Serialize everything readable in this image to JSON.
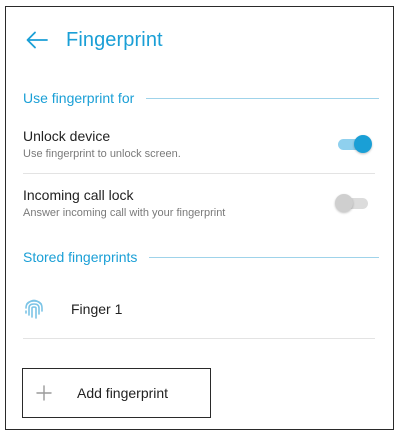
{
  "header": {
    "title": "Fingerprint",
    "back_icon": "arrow-left-icon"
  },
  "sections": {
    "use_for": {
      "title": "Use fingerprint for"
    },
    "stored": {
      "title": "Stored fingerprints"
    }
  },
  "prefs": {
    "unlock": {
      "title": "Unlock device",
      "summary": "Use fingerprint to unlock screen.",
      "enabled": true
    },
    "call_lock": {
      "title": "Incoming call lock",
      "summary": "Answer incoming call with your fingerprint",
      "enabled": false
    }
  },
  "fingerprints": {
    "items": [
      {
        "label": "Finger 1",
        "icon": "fingerprint-icon"
      }
    ],
    "add_label": "Add fingerprint",
    "add_icon": "plus-icon"
  },
  "colors": {
    "accent": "#1a9fd6",
    "accent_light": "#8fd0ee",
    "switch_off_track": "#dcdcdc",
    "switch_off_thumb": "#cfcfcf",
    "fingerprint": "#7cc4e6"
  }
}
